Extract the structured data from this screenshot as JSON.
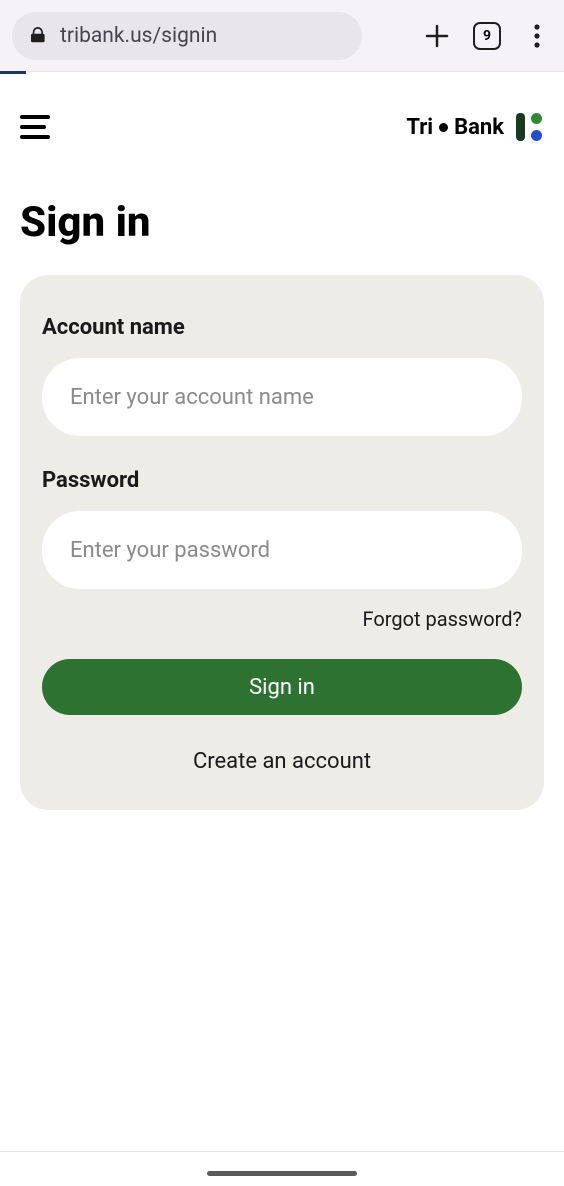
{
  "browser": {
    "url": "tribank.us/signin",
    "tab_count": "9"
  },
  "header": {
    "brand_left": "Tri",
    "brand_right": "Bank"
  },
  "page": {
    "title": "Sign in"
  },
  "form": {
    "account_label": "Account name",
    "account_placeholder": "Enter your account name",
    "password_label": "Password",
    "password_placeholder": "Enter your password",
    "forgot_link": "Forgot password?",
    "signin_button": "Sign in",
    "create_link": "Create an account"
  },
  "colors": {
    "signin_button": "#2e7232",
    "card_bg": "#edece6"
  }
}
